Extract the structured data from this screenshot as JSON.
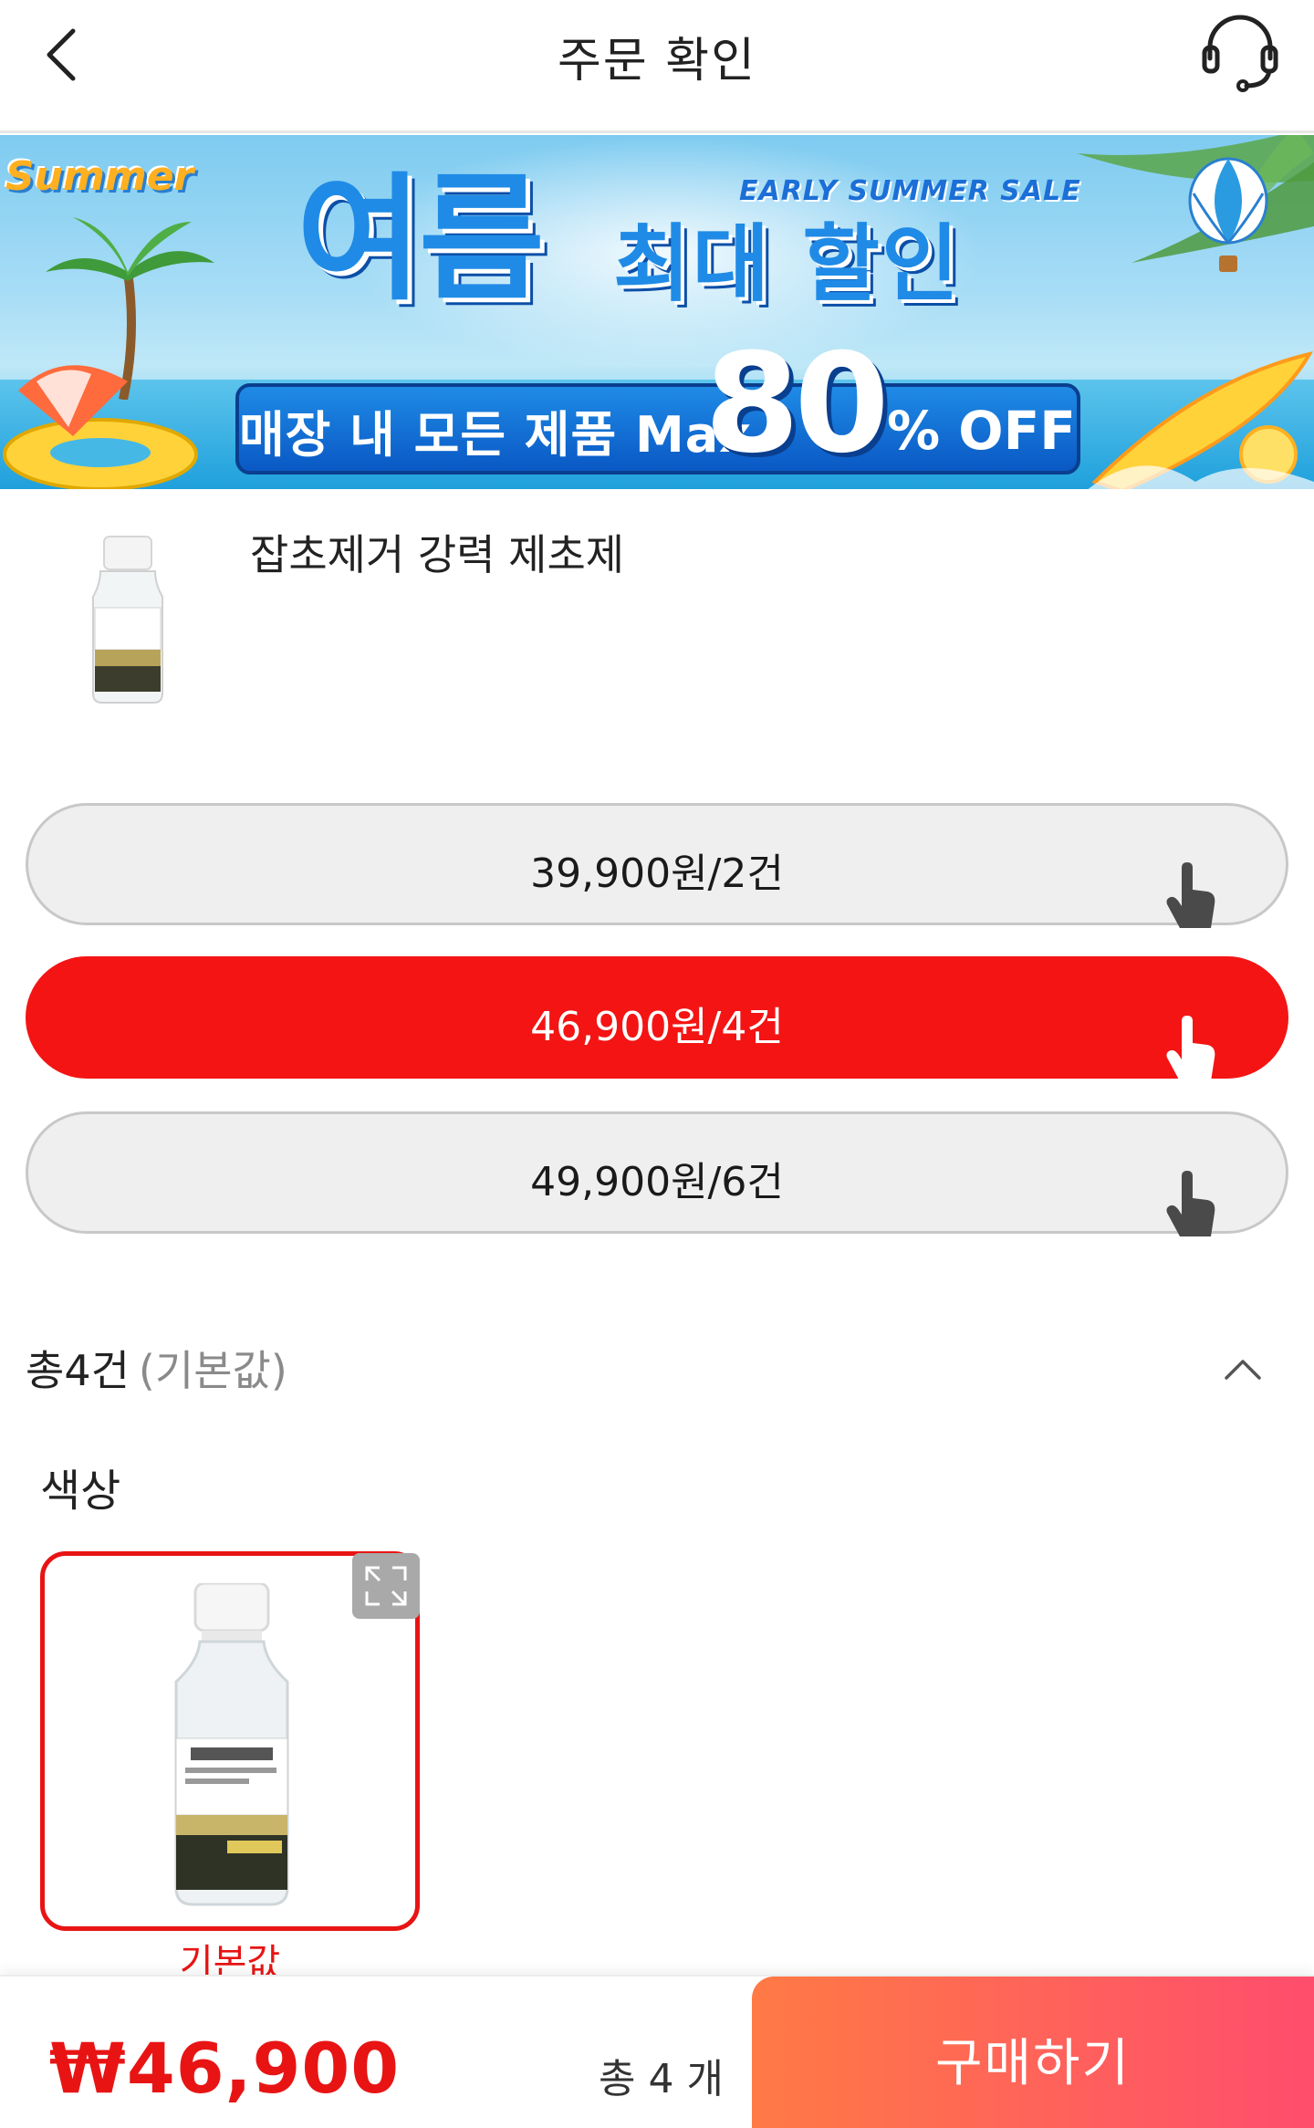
{
  "header": {
    "title": "주문 확인",
    "back_icon": "chevron-left-icon",
    "support_icon": "headset-icon"
  },
  "banner": {
    "logo_text": "Summer",
    "tagline": "EARLY SUMMER SALE",
    "headline_big": "여름",
    "headline_rest": "최대 할인",
    "promo_text": "매장 내 모든 제품 Max",
    "promo_number": "80",
    "promo_suffix": "% OFF",
    "accent_color": "#1f8be6"
  },
  "product": {
    "name": "잡초제거 강력 제초제"
  },
  "options": [
    {
      "label": "39,900원/2건",
      "selected": false
    },
    {
      "label": "46,900원/4건",
      "selected": true
    },
    {
      "label": "49,900원/6건",
      "selected": false
    }
  ],
  "summary": {
    "count_label": "총4건",
    "default_label": "(기본값)",
    "collapse_icon": "chevron-up-icon"
  },
  "color": {
    "title": "색상",
    "swatch_caption": "기본값",
    "expand_icon": "expand-icon"
  },
  "bottom": {
    "price": "₩46,900",
    "count": "총 4 개",
    "buy_label": "구매하기",
    "accent_color": "#e81414"
  }
}
